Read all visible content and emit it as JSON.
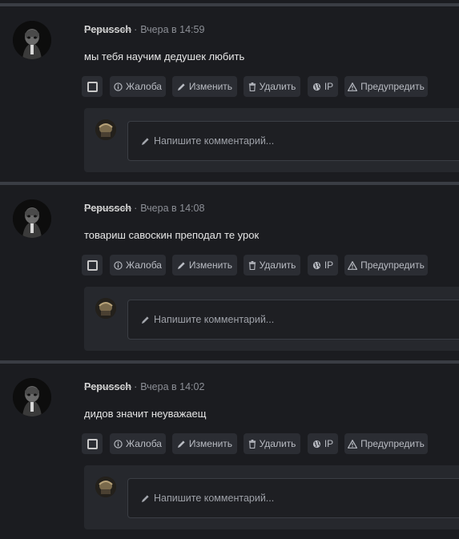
{
  "comment_placeholder": "Напишите комментарий...",
  "actions": {
    "report": "Жалоба",
    "edit": "Изменить",
    "delete": "Удалить",
    "ip": "IP",
    "warn": "Предупредить"
  },
  "posts": [
    {
      "author": "Pepussch",
      "time": "Вчера в 14:59",
      "text": "мы тебя научим дедушек любить"
    },
    {
      "author": "Pepussch",
      "time": "Вчера в 14:08",
      "text": "товариш савоскин преподал те урок"
    },
    {
      "author": "Pepussch",
      "time": "Вчера в 14:02",
      "text": "дидов значит неуважаещ"
    }
  ],
  "icons": {
    "report": "info-circle-icon",
    "edit": "pencil-icon",
    "delete": "trash-icon",
    "ip": "globe-icon",
    "warn": "warning-triangle-icon",
    "comment": "pencil-icon"
  }
}
